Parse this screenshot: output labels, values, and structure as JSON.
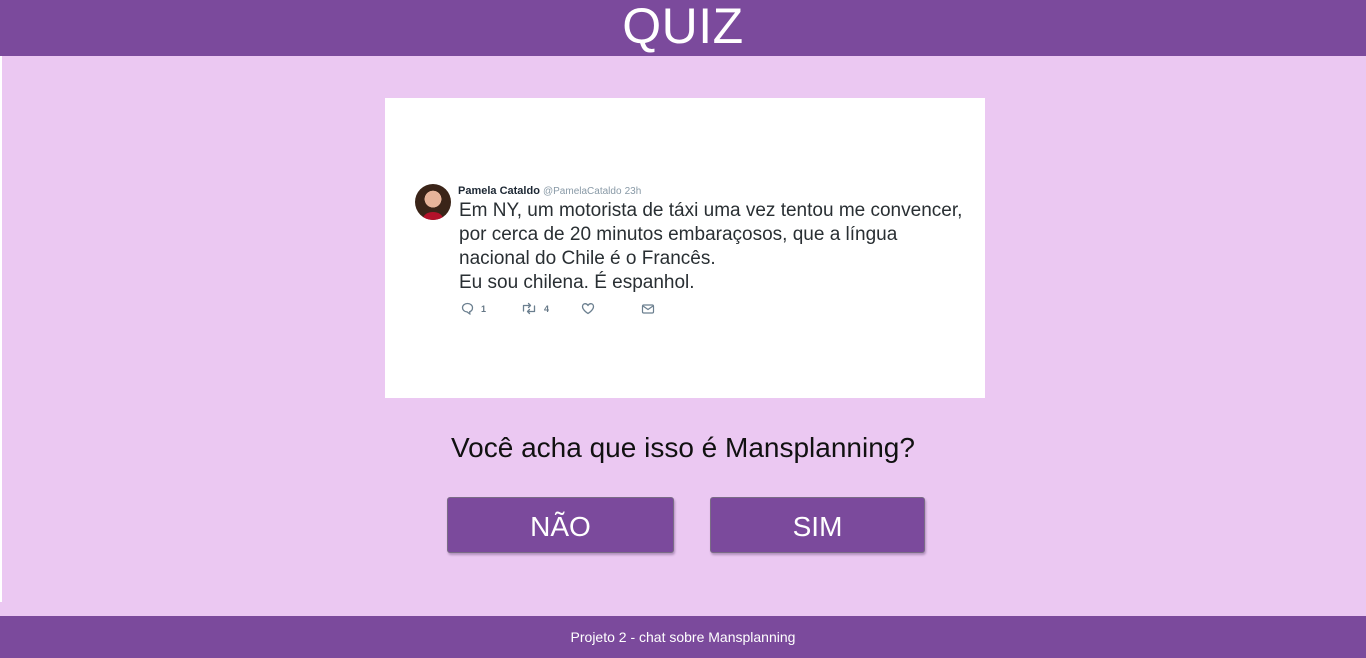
{
  "header": {
    "title": "QUIZ"
  },
  "tweet": {
    "author_name": "Pamela Cataldo",
    "author_handle": "@PamelaCataldo",
    "time": "23h",
    "text_lines": [
      "Em NY, um motorista de táxi uma vez tentou me convencer, por cerca de 20 minutos embaraçosos, que a língua nacional do Chile é o Francês.",
      "Eu sou chilena. É espanhol."
    ],
    "reply_count": "1",
    "retweet_count": "4",
    "icons": {
      "reply": "reply-icon",
      "retweet": "retweet-icon",
      "like": "heart-icon",
      "message": "message-icon"
    }
  },
  "quiz": {
    "question": "Você acha que isso é Mansplanning?",
    "buttons": {
      "no": "NÃO",
      "yes": "SIM"
    }
  },
  "footer": {
    "text": "Projeto 2 - chat sobre Mansplanning"
  },
  "colors": {
    "header_footer": "#7b4a9c",
    "background": "#ebc8f2",
    "button": "#7b4a9c",
    "tweet_card": "#ffffff"
  }
}
